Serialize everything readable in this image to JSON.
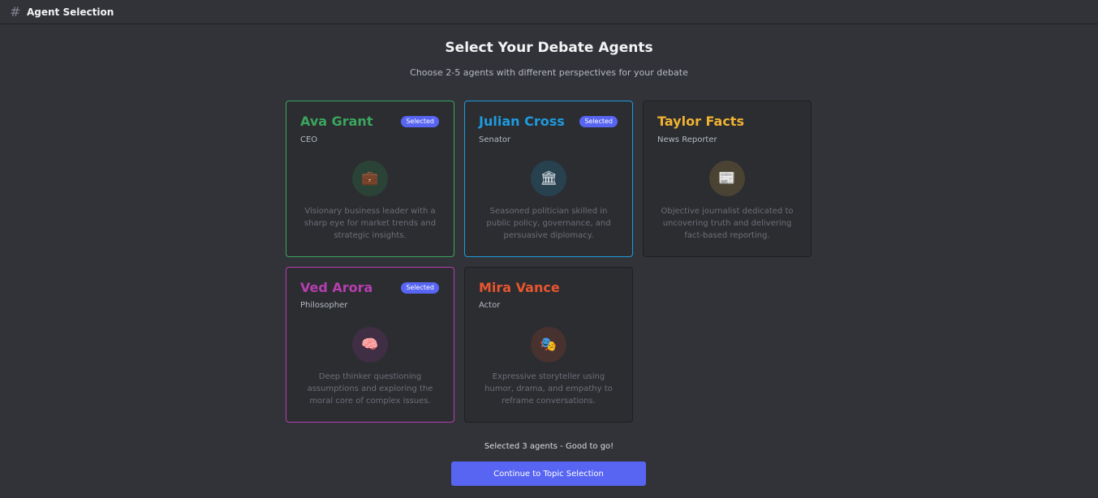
{
  "header": {
    "title": "Agent Selection",
    "icon": "hash-icon"
  },
  "main": {
    "title": "Select Your Debate Agents",
    "subtitle": "Choose 2-5 agents with different perspectives for your debate"
  },
  "agents": [
    {
      "name": "Ava Grant",
      "role": "CEO",
      "selected": true,
      "badge": "Selected",
      "icon": "briefcase-icon",
      "glyph": "💼",
      "description": "Visionary business leader with a sharp eye for market trends and strategic insights.",
      "color": "#3ba55d"
    },
    {
      "name": "Julian Cross",
      "role": "Senator",
      "selected": true,
      "badge": "Selected",
      "icon": "government-building-icon",
      "glyph": "🏛",
      "description": "Seasoned politician skilled in public policy, governance, and persuasive diplomacy.",
      "color": "#1e9bdf"
    },
    {
      "name": "Taylor Facts",
      "role": "News Reporter",
      "selected": false,
      "badge": "",
      "icon": "newspaper-icon",
      "glyph": "📰",
      "description": "Objective journalist dedicated to uncovering truth and delivering fact-based reporting.",
      "color": "#f0b232"
    },
    {
      "name": "Ved Arora",
      "role": "Philosopher",
      "selected": true,
      "badge": "Selected",
      "icon": "brain-icon",
      "glyph": "🧠",
      "description": "Deep thinker questioning assumptions and exploring the moral core of complex issues.",
      "color": "#b73eb0"
    },
    {
      "name": "Mira Vance",
      "role": "Actor",
      "selected": false,
      "badge": "",
      "icon": "theater-masks-icon",
      "glyph": "🎭",
      "description": "Expressive storyteller using humor, drama, and empathy to reframe conversations.",
      "color": "#e8552f"
    }
  ],
  "footer": {
    "status": "Selected 3 agents - Good to go!",
    "continue_label": "Continue to Topic Selection"
  }
}
